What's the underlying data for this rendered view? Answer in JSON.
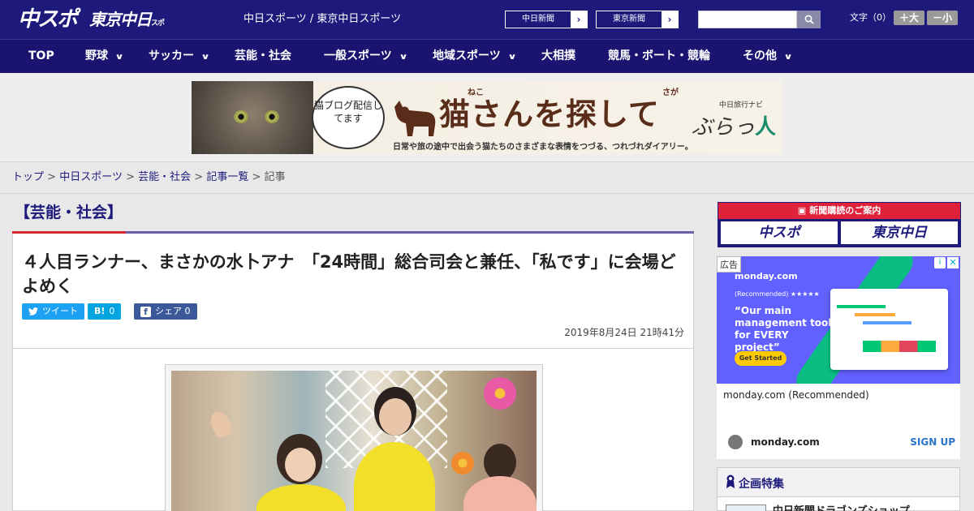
{
  "header": {
    "logo_main": "中スポ",
    "logo_sub": "東京中日",
    "logo_sub_small": "スポーツ",
    "site_title": "中日スポーツ / 東京中日スポーツ",
    "ext_links": [
      {
        "label": "中日新聞",
        "arrow": "›"
      },
      {
        "label": "東京新聞",
        "arrow": "›"
      }
    ],
    "search": {
      "placeholder": "",
      "icon": "search-icon"
    },
    "font_size": {
      "label": "文字（0）",
      "increase": "＋大",
      "decrease": "－小"
    }
  },
  "nav": {
    "items": [
      {
        "label": "TOP",
        "dropdown": false
      },
      {
        "label": "野球",
        "dropdown": true
      },
      {
        "label": "サッカー",
        "dropdown": true
      },
      {
        "label": "芸能・社会",
        "dropdown": false
      },
      {
        "label": "一般スポーツ",
        "dropdown": true
      },
      {
        "label": "地域スポーツ",
        "dropdown": true
      },
      {
        "label": "大相撲",
        "dropdown": false
      },
      {
        "label": "競馬・ボート・競輪",
        "dropdown": false
      },
      {
        "label": "その他",
        "dropdown": true
      }
    ],
    "chevron": "∨"
  },
  "banner": {
    "bubble_text": "猫ブログ配信してます",
    "ruby_1": "ねこ",
    "ruby_2": "さが",
    "title": "猫さんを探して",
    "navi_small": "中日旅行ナビ",
    "navi_brand": "ぶらっ",
    "navi_brand_accent": "人",
    "subtitle": "日常や旅の途中で出会う猫たちのさまざまな表情をつづる、つれづれダイアリー。"
  },
  "breadcrumb": {
    "items": [
      "トップ",
      "中日スポーツ",
      "芸能・社会",
      "記事一覧"
    ],
    "separator": ">",
    "current": "記事"
  },
  "article": {
    "category": "【芸能・社会】",
    "headline": "４人目ランナー、まさかの水卜アナ　「24時間」総合司会と兼任、「私です」に会場どよめく",
    "share": {
      "tweet": {
        "glyph": "🐦",
        "label": "ツイート"
      },
      "hatena": {
        "glyph": "B!",
        "count": "0"
      },
      "facebook": {
        "glyph": "f",
        "label": "シェア",
        "count": "0"
      }
    },
    "date": "2019年8月24日 21時41分"
  },
  "sidebar": {
    "subscribe": {
      "title": "新聞購読のご案内",
      "logos": [
        "中スポ",
        "東京中日"
      ]
    },
    "ad": {
      "badge": "広告",
      "brand": "monday.com",
      "recommended": "(Recommended) ★★★★★",
      "quote": "“Our main management tool for EVERY project”",
      "cta": "Get Started",
      "name": "monday.com (Recommended)",
      "domain": "monday.com",
      "signup": "SIGN UP",
      "info": "i",
      "close": "✕"
    },
    "feature": {
      "title": "企画特集",
      "item": "中日新聞ドラゴンズショップ"
    }
  },
  "colors": {
    "header_bg": "#1d1a7c",
    "nav_bg": "#1a1470",
    "accent_red": "#d6262d",
    "rule_purple": "#6b5fa6",
    "twitter": "#1da1f2",
    "hatena": "#00a4de",
    "facebook": "#3b5998"
  }
}
